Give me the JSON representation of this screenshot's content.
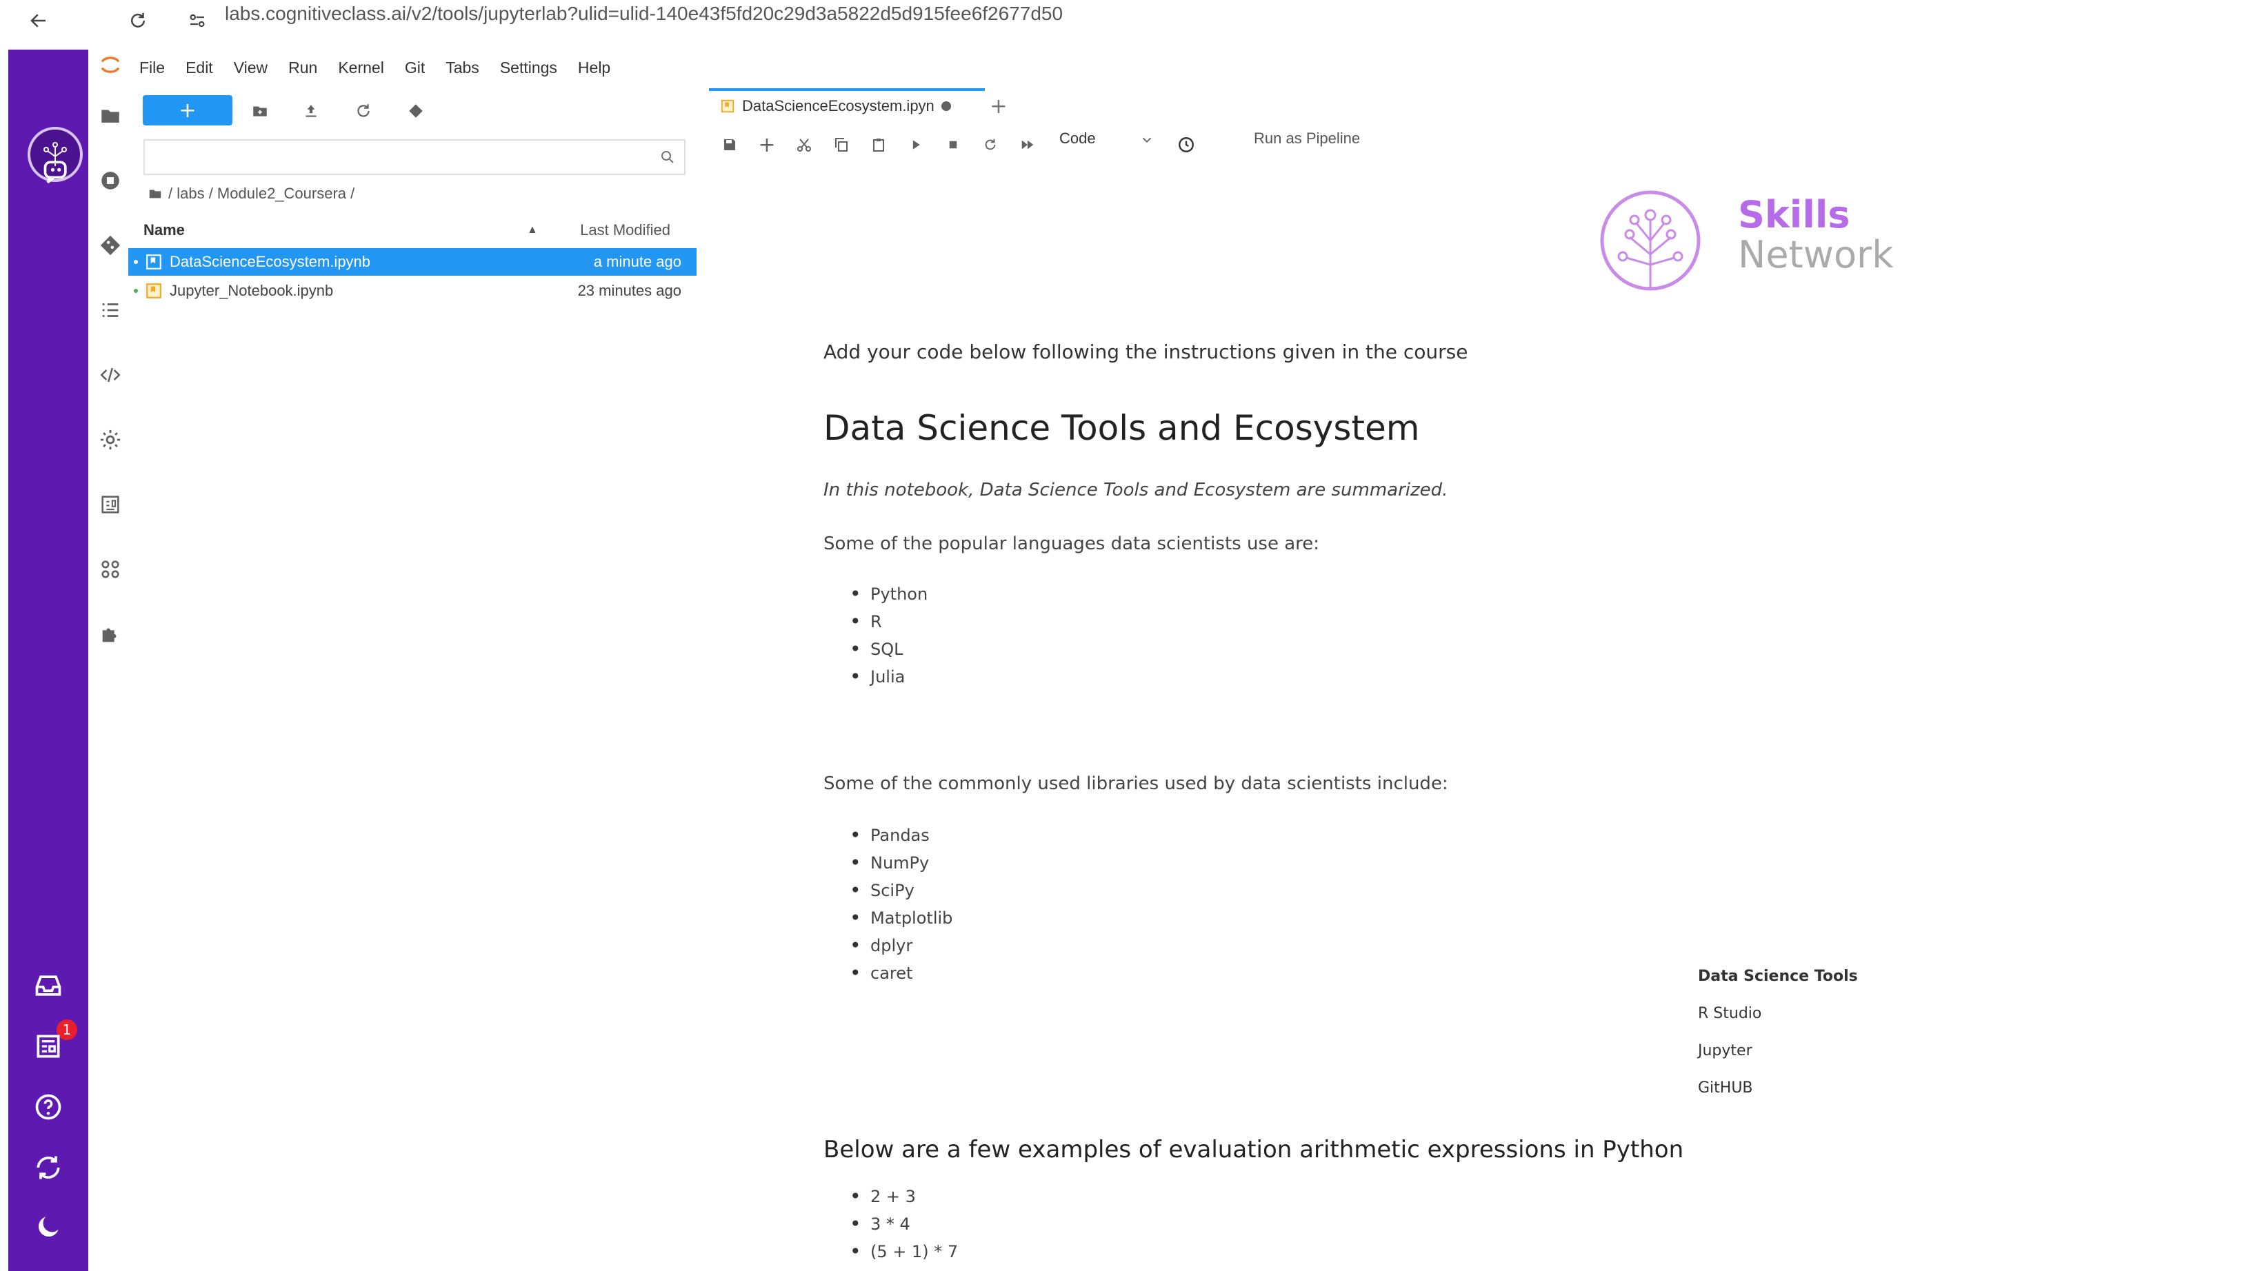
{
  "browser": {
    "url": "labs.cognitiveclass.ai/v2/tools/jupyterlab?ulid=ulid-140e43f5fd20c29d3a5822d5d915fee6f2677d50"
  },
  "sidebar": {
    "notification_count": "1"
  },
  "menu": {
    "items": [
      "File",
      "Edit",
      "View",
      "Run",
      "Kernel",
      "Git",
      "Tabs",
      "Settings",
      "Help"
    ]
  },
  "file_browser": {
    "new_label": "+",
    "search_placeholder": "",
    "breadcrumb": "/ labs / Module2_Coursera /",
    "col_name": "Name",
    "col_modified": "Last Modified",
    "files": [
      {
        "name": "DataScienceEcosystem.ipynb",
        "modified": "a minute ago",
        "selected": true
      },
      {
        "name": "Jupyter_Notebook.ipynb",
        "modified": "23 minutes ago",
        "selected": false
      }
    ]
  },
  "editor": {
    "tab_label": "DataScienceEcosystem.ipyn",
    "cell_type": "Code",
    "pipeline_label": "Run as Pipeline"
  },
  "notebook": {
    "logo_line1": "Skills",
    "logo_line2": "Network",
    "instructions": "Add your code below following the instructions given in the course",
    "title": "Data Science Tools and Ecosystem",
    "intro": "In this notebook, Data Science Tools and Ecosystem are summarized.",
    "languages_intro": "Some of the popular languages data scientists use are:",
    "languages": [
      "Python",
      "R",
      "SQL",
      "Julia"
    ],
    "libraries_intro": "Some of the commonly used libraries used by data scientists include:",
    "libraries": [
      "Pandas",
      "NumPy",
      "SciPy",
      "Matplotlib",
      "dplyr",
      "caret"
    ],
    "tools_table": {
      "header": "Data Science Tools",
      "rows": [
        "R Studio",
        "Jupyter",
        "GitHUB"
      ]
    },
    "examples_heading": "Below are a few examples of evaluation arithmetic expressions in Python",
    "expressions": [
      "2 + 3",
      "3 * 4",
      "(5 + 1) * 7"
    ]
  },
  "colors": {
    "sn_purple": "#5e1ab0",
    "accent_blue": "#2196f3",
    "skills_purple": "#b66be8",
    "badge_red": "#e8202e"
  }
}
